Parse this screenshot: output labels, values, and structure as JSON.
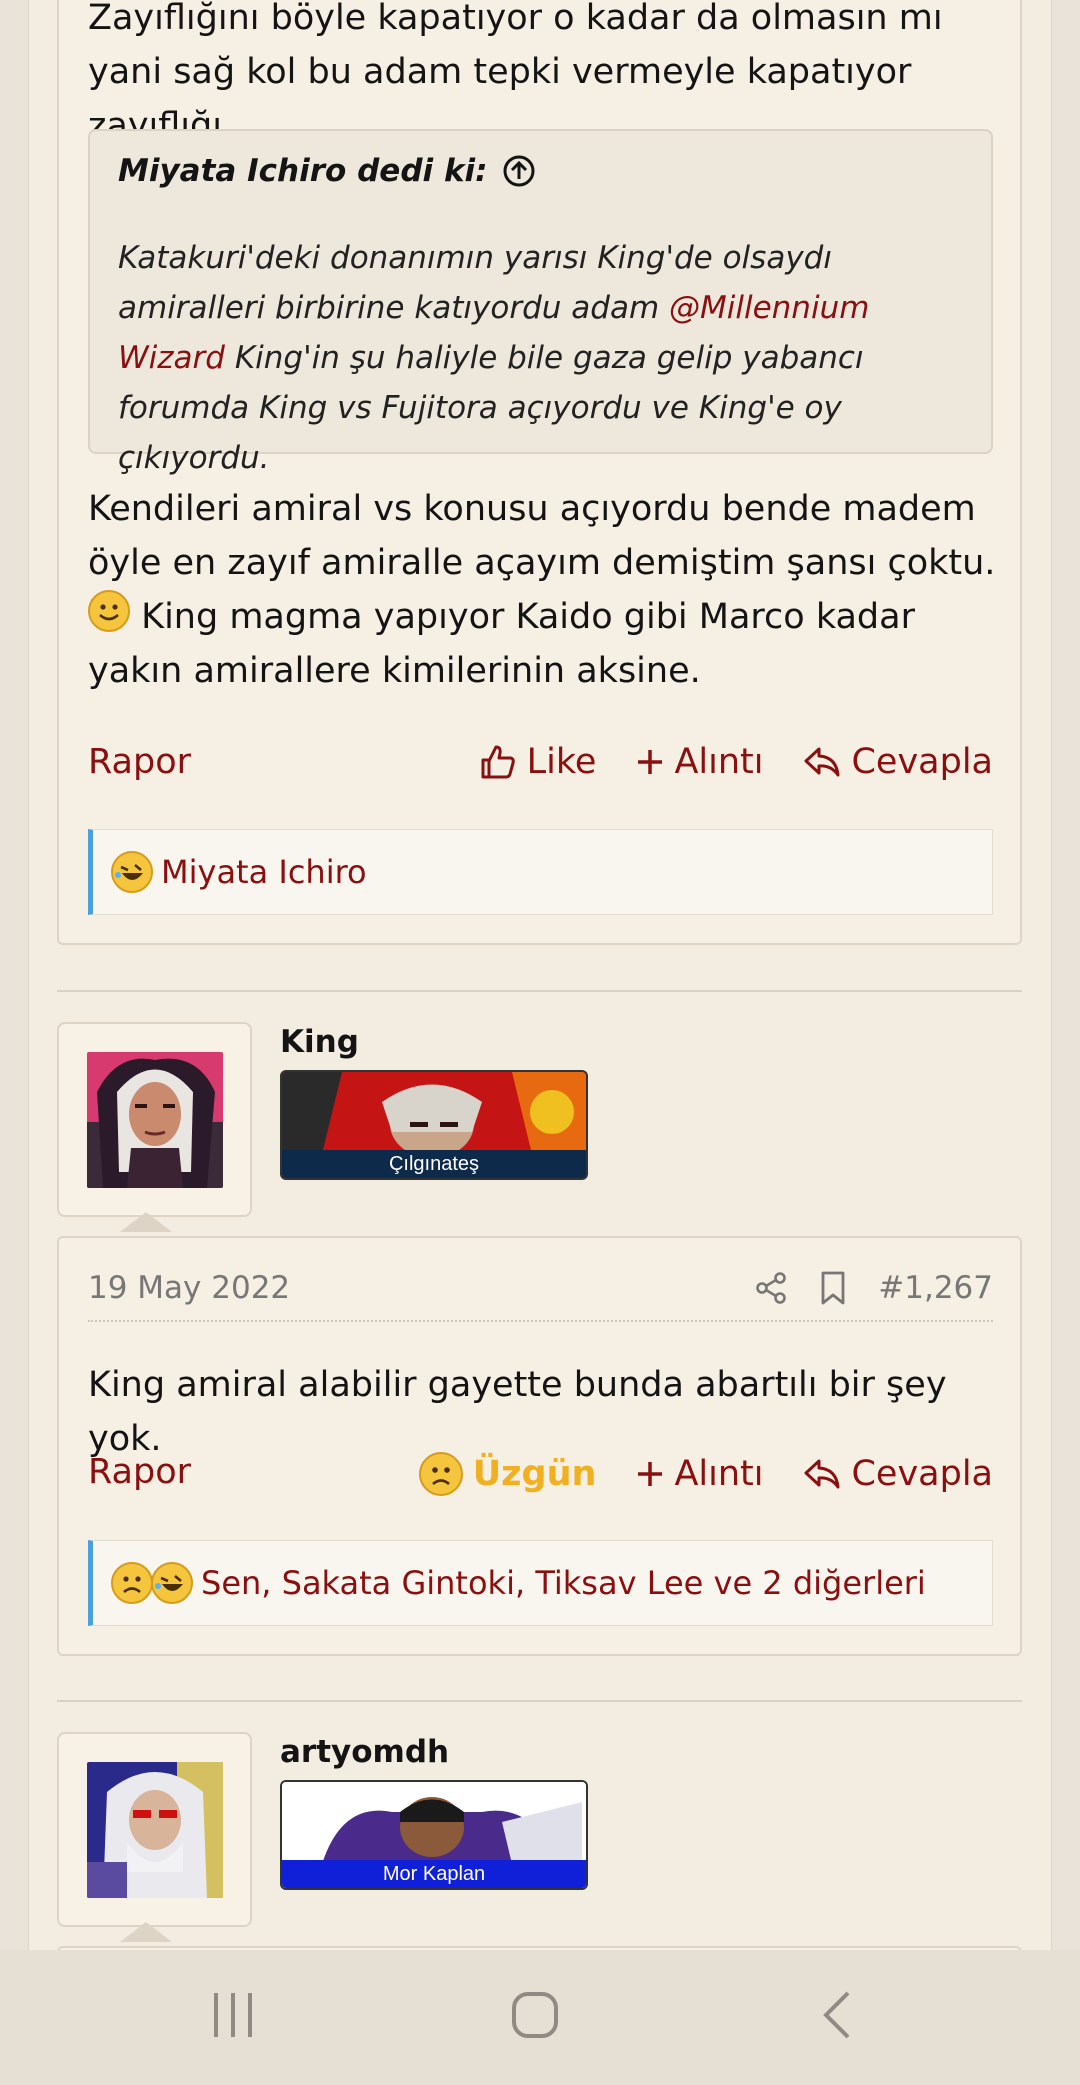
{
  "post1": {
    "text_top": "Zayıflığını böyle kapatıyor o kadar da olmasın mı yani sağ kol bu adam tepki vermeyle kapatıyor zayıflığı.",
    "quote": {
      "header": "Miyata Ichiro dedi ki:",
      "text_before": "Katakuri'deki donanımın yarısı King'de olsaydı amiralleri birbirine katıyordu adam ",
      "mention": "@Millennium Wizard",
      "text_after": " King'in şu haliyle bile gaza gelip yabancı forumda King vs Fujitora açıyordu ve King'e oy çıkıyordu."
    },
    "text_main_before": "Kendileri amiral vs konusu açıyordu bende madem öyle en zayıf amiralle açayım demiştim şansı çoktu. ",
    "text_main_after": " King magma yapıyor Kaido gibi Marco kadar yakın amirallere kimilerinin aksine.",
    "actions": {
      "report": "Rapor",
      "like": "Like",
      "quote": "Alıntı",
      "reply": "Cevapla"
    },
    "reactions": "Miyata Ichiro"
  },
  "post2": {
    "username": "King",
    "banner_label": "Çılgınateş",
    "date": "19 May 2022",
    "post_number": "#1,267",
    "text": "King amiral alabilir gayette bunda abartılı bir şey yok.",
    "actions": {
      "report": "Rapor",
      "reaction": "Üzgün",
      "quote": "Alıntı",
      "reply": "Cevapla"
    },
    "reactions": "Sen, Sakata Gintoki, Tiksav Lee ve 2 diğerleri"
  },
  "post3": {
    "username": "artyomdh",
    "banner_label": "Mor Kaplan"
  },
  "colors": {
    "link": "#8a1010",
    "accent": "#4a9fe0",
    "sad_reaction": "#f0b020"
  },
  "icons": [
    "up-circle-icon",
    "like-icon",
    "plus-icon",
    "reply-icon",
    "laugh-emoji",
    "smile-emoji",
    "sad-emoji",
    "share-icon",
    "bookmark-icon",
    "recents-icon",
    "home-icon",
    "back-icon"
  ]
}
